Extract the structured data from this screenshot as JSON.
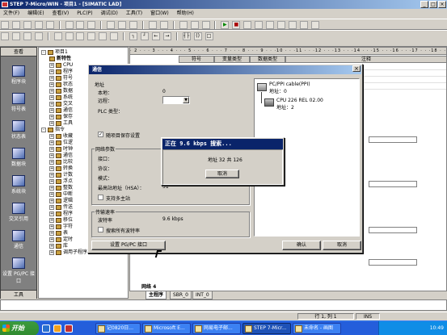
{
  "app": {
    "title": "STEP 7-Micro/WIN - 项目1 - [SIMATIC LAD]",
    "menu": [
      "文件(F)",
      "编辑(E)",
      "查看(V)",
      "PLC(P)",
      "调试(D)",
      "工具(T)",
      "窗口(W)",
      "帮助(H)"
    ]
  },
  "nav": {
    "header": "查看",
    "items": [
      "程序块",
      "符号表",
      "状态表",
      "数据块",
      "系统块",
      "交叉引用",
      "通信",
      "设置 PG/PC 接口"
    ],
    "footer": "工具"
  },
  "tree": {
    "rows": [
      {
        "sign": "-",
        "label": "项目1"
      },
      {
        "sign": "",
        "label": "新特性"
      },
      {
        "sign": "+",
        "label": "CPU"
      },
      {
        "sign": "+",
        "label": "程序"
      },
      {
        "sign": "+",
        "label": "符号"
      },
      {
        "sign": "+",
        "label": "状态"
      },
      {
        "sign": "+",
        "label": "数据"
      },
      {
        "sign": "+",
        "label": "系统"
      },
      {
        "sign": "+",
        "label": "交叉"
      },
      {
        "sign": "+",
        "label": "通信"
      },
      {
        "sign": "+",
        "label": "保存"
      },
      {
        "sign": "+",
        "label": "工具"
      },
      {
        "sign": "-",
        "label": "指令"
      },
      {
        "sign": "+",
        "label": "收藏"
      },
      {
        "sign": "+",
        "label": "位逻"
      },
      {
        "sign": "+",
        "label": "时钟"
      },
      {
        "sign": "+",
        "label": "通信"
      },
      {
        "sign": "+",
        "label": "比较"
      },
      {
        "sign": "+",
        "label": "转换"
      },
      {
        "sign": "+",
        "label": "计数"
      },
      {
        "sign": "+",
        "label": "浮点"
      },
      {
        "sign": "+",
        "label": "整数"
      },
      {
        "sign": "+",
        "label": "中断"
      },
      {
        "sign": "+",
        "label": "逻辑"
      },
      {
        "sign": "+",
        "label": "传送"
      },
      {
        "sign": "+",
        "label": "程序"
      },
      {
        "sign": "+",
        "label": "移位"
      },
      {
        "sign": "+",
        "label": "字符"
      },
      {
        "sign": "+",
        "label": "表"
      },
      {
        "sign": "+",
        "label": "定时"
      },
      {
        "sign": "+",
        "label": "库"
      },
      {
        "sign": "+",
        "label": "调用子程序"
      }
    ]
  },
  "editor": {
    "ruler": "· 2 · · · 3 · · · 4 · · · 5 · · · 6 · · · 7 · · · 8 · · · 9 · · ·10 · · ·11 · · ·12 · · ·13 · · ·14 · · ·15 · · ·16 · · ·17 · · ·18 · ·",
    "columns": [
      "符号",
      "变量类型",
      "数据类型",
      "注释"
    ],
    "network_label": "网络 4",
    "tabs": [
      "主程序",
      "SBR_0",
      "INT_0"
    ]
  },
  "comm_dialog": {
    "title": "通信",
    "address_group": "地址",
    "local_label": "本地：",
    "local_value": "0",
    "remote_label": "远程：",
    "plc_type_label": "PLC 类型：",
    "save_settings_label": "随项目保存设置",
    "network_group": "网络参数",
    "interface_label": "接口：",
    "protocol_label": "协议：",
    "mode_label": "模式：",
    "hsa_label": "最高站地址（HSA）：",
    "hsa_value": "31",
    "multi_master_label": "支持多主站",
    "baud_group": "传输速率",
    "baud_label": "波特率",
    "baud_value": "9.6 kbps",
    "search_all_label": "搜索所有波特率",
    "setup_button": "设置 PG/PC 接口",
    "ok_button": "确认",
    "cancel_button": "取消",
    "network_pane": {
      "cable_title": "PC/PPI cable(PPI)",
      "cable_address": "地址：0",
      "cpu_title": "CPU 226 REL 02.00",
      "cpu_address": "地址：2"
    }
  },
  "search_dialog": {
    "title": "正在 9.6 kbps 搜索...",
    "progress_text": "地址 32 共 126",
    "cancel_button": "取消"
  },
  "statusbar": {
    "right_cells": [
      "行 1, 列 1",
      "INS"
    ]
  },
  "taskbar": {
    "start_label": "开始",
    "tasks": [
      "记0820日...",
      "Microsoft E...",
      "网易电子邮...",
      "STEP 7-Micr...",
      "未命名 - 画图"
    ],
    "clock": "10:49"
  }
}
